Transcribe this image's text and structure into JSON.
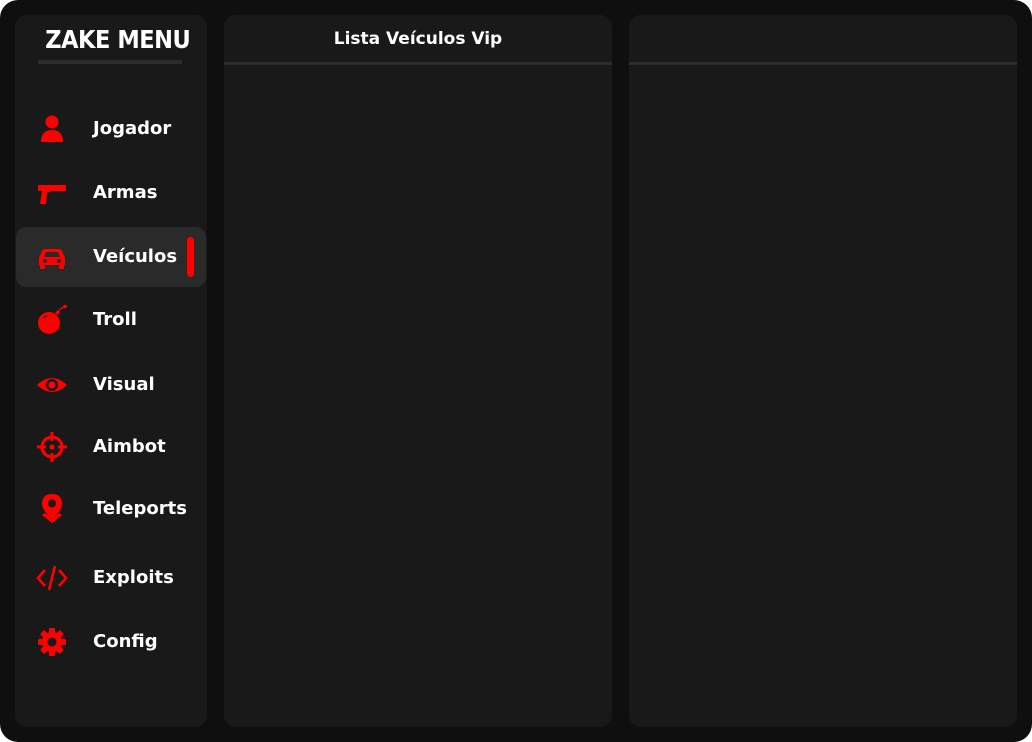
{
  "app": {
    "title": "ZAKE MENU",
    "accent_color": "#ff0000"
  },
  "sidebar": {
    "items": [
      {
        "label": "Jogador",
        "icon": "user-icon",
        "active": false
      },
      {
        "label": "Armas",
        "icon": "pistol-icon",
        "active": false
      },
      {
        "label": "Veículos",
        "icon": "car-icon",
        "active": true
      },
      {
        "label": "Troll",
        "icon": "bomb-icon",
        "active": false
      },
      {
        "label": "Visual",
        "icon": "eye-icon",
        "active": false
      },
      {
        "label": "Aimbot",
        "icon": "crosshair-icon",
        "active": false
      },
      {
        "label": "Teleports",
        "icon": "map-pin-icon",
        "active": false
      },
      {
        "label": "Exploits",
        "icon": "code-icon",
        "active": false
      },
      {
        "label": "Config",
        "icon": "gear-icon",
        "active": false
      }
    ]
  },
  "left_panel": {
    "title": "Lista Veículos Vip"
  },
  "right_panel": {
    "title": ""
  }
}
